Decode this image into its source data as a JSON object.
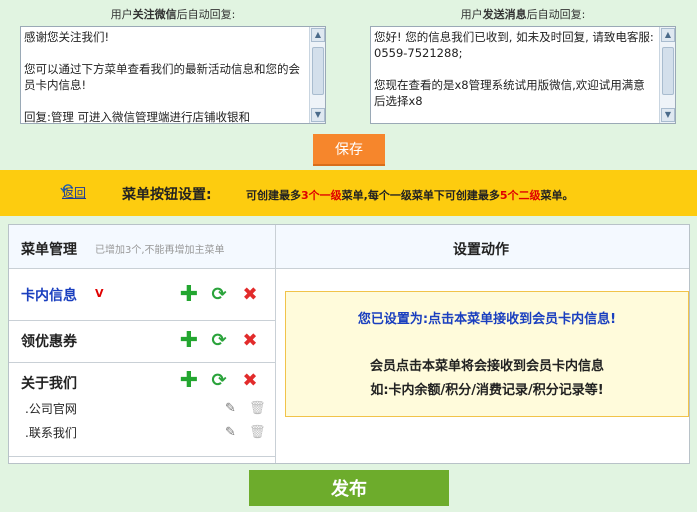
{
  "left_reply": {
    "label_prefix": "用户",
    "label_bold": "关注微信",
    "label_suffix": "后自动回复:",
    "text": "感谢您关注我们!\n\n您可以通过下方菜单查看我们的最新活动信息和您的会员卡内信息!\n\n回复:管理 可进入微信管理端进行店铺收银和"
  },
  "right_reply": {
    "label_prefix": "用户",
    "label_bold": "发送消息",
    "label_suffix": "后自动回复:",
    "text": "您好! 您的信息我们已收到, 如未及时回复, 请致电客服: 0559-7521288;\n\n您现在查看的是x8管理系统试用版微信,欢迎试用满意后选择x8"
  },
  "save_label": "保存",
  "banner": {
    "back_label": "返回",
    "title": "菜单按钮设置:",
    "note_1": "可创建最多",
    "note_red_1": "3个一级",
    "note_2": "菜单,每个一级菜单下可创建最多",
    "note_red_2": "5个二级",
    "note_3": "菜单。"
  },
  "menu_panel": {
    "title": "菜单管理",
    "note": "已增加3个,不能再增加主菜单",
    "items": [
      {
        "name": "卡内信息",
        "selected_mark": "V"
      },
      {
        "name": "领优惠券"
      },
      {
        "name": "关于我们",
        "subitems": [
          ".公司官网",
          ".联系我们"
        ]
      }
    ]
  },
  "action_panel": {
    "title": "设置动作",
    "line1": "您已设置为:点击本菜单接收到会员卡内信息!",
    "line2": "会员点击本菜单将会接收到会员卡内信息",
    "line3": "如:卡内余额/积分/消费记录/积分记录等!"
  },
  "publish_label": "发布",
  "icons": {
    "add": "plus-icon",
    "edit": "refresh-icon",
    "delete": "delete-x-icon",
    "sub_edit": "pencil-icon",
    "sub_delete": "trash-icon",
    "back": "back-arrow-icon"
  },
  "colors": {
    "background": "#e1f4e1",
    "banner": "#fdcc0f",
    "save_button": "#f6862c",
    "publish_button": "#6dac2c",
    "accent_blue": "#1a3fbf",
    "accent_red": "#e00000"
  }
}
